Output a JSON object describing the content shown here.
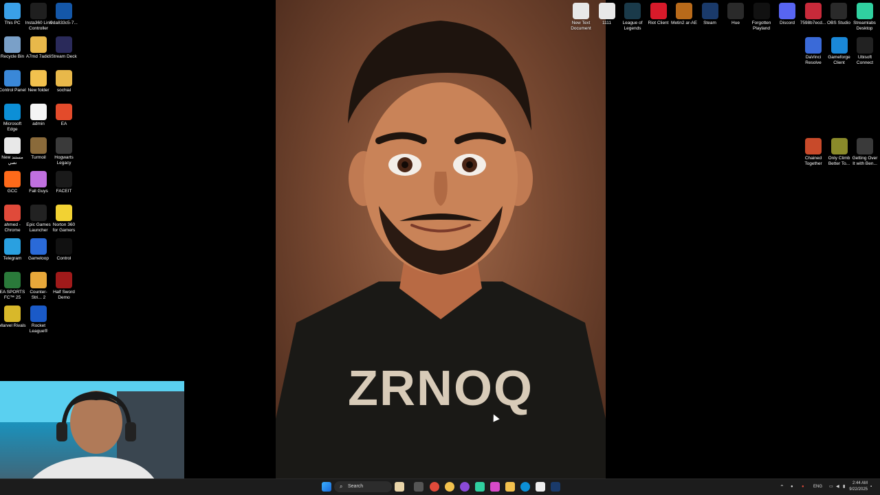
{
  "left_icons": [
    {
      "label": "This PC",
      "color": "#3aa0e8"
    },
    {
      "label": "Insta360 Link Controller",
      "color": "#1f1f1f"
    },
    {
      "label": "9da833c5-7...",
      "color": "#1457a8"
    },
    {
      "label": "Recycle Bin",
      "color": "#7aa0c8"
    },
    {
      "label": "A7md 7adidi",
      "color": "#e8b84a"
    },
    {
      "label": "Stream Deck",
      "color": "#2a2a5a"
    },
    {
      "label": "Control Panel",
      "color": "#3a88d8"
    },
    {
      "label": "New folder",
      "color": "#f2c14e"
    },
    {
      "label": "sochial",
      "color": "#e8b84a"
    },
    {
      "label": "Microsoft Edge",
      "color": "#0c8fd6"
    },
    {
      "label": "admin",
      "color": "#f5f5f5"
    },
    {
      "label": "EA",
      "color": "#e34b2b"
    },
    {
      "label": "New مستند نصي",
      "color": "#e8e8e8"
    },
    {
      "label": "Turmoil",
      "color": "#8a6a3a"
    },
    {
      "label": "Hogwarts Legacy",
      "color": "#3a3a3a"
    },
    {
      "label": "GCC",
      "color": "#ff6a1a"
    },
    {
      "label": "Fall Guys",
      "color": "#c070e0"
    },
    {
      "label": "FACEIT",
      "color": "#1a1a1a"
    },
    {
      "label": "ahmed - Chrome",
      "color": "#e04a3a"
    },
    {
      "label": "Epic Games Launcher",
      "color": "#222"
    },
    {
      "label": "Norton 360 for Gamers",
      "color": "#f2d233"
    },
    {
      "label": "Telegram",
      "color": "#2aa0e0"
    },
    {
      "label": "Gameloop",
      "color": "#2a6ad8"
    },
    {
      "label": "Control",
      "color": "#111"
    },
    {
      "label": "EA SPORTS FC™ 25",
      "color": "#2a7a3a"
    },
    {
      "label": "Counter-Stri... 2",
      "color": "#e8a83a"
    },
    {
      "label": "Half Sword Demo",
      "color": "#a01a1a"
    },
    {
      "label": "Marvel Rivals",
      "color": "#d8b82a"
    },
    {
      "label": "Rocket League®",
      "color": "#1a5ac8"
    }
  ],
  "right_icons_row1": [
    {
      "label": "New Text Document",
      "color": "#e8e8e8"
    },
    {
      "label": "1111",
      "color": "#e8e8e8"
    },
    {
      "label": "League of Legends",
      "color": "#1a3a4a"
    },
    {
      "label": "Riot Client",
      "color": "#d81a2a"
    },
    {
      "label": "Metin2 ar-AE",
      "color": "#b86a1a"
    },
    {
      "label": "Steam",
      "color": "#1a3a6a"
    },
    {
      "label": "Hue",
      "color": "#2a2a2a"
    },
    {
      "label": "Forgotten Playland",
      "color": "#111"
    },
    {
      "label": "Discord",
      "color": "#5865f2"
    },
    {
      "label": "7598b7ecd...",
      "color": "#c82a3a"
    },
    {
      "label": "OBS Studio",
      "color": "#2a2a2a"
    },
    {
      "label": "Streamlabs Desktop",
      "color": "#30d0a0"
    }
  ],
  "right_icons_row2": [
    {
      "label": "DaVinci Resolve",
      "color": "#3a6ad8"
    },
    {
      "label": "Gameforge Client",
      "color": "#1a88d8"
    },
    {
      "label": "Ubisoft Connect",
      "color": "#222"
    }
  ],
  "right_icons_row3": [
    {
      "label": "Chained Together",
      "color": "#c84a2a"
    },
    {
      "label": "Only Climb Better To...",
      "color": "#8a8a2a"
    },
    {
      "label": "Getting Over It with Ben...",
      "color": "#3a3a3a"
    }
  ],
  "wallpaper": {
    "shirt_text": "ZRNOQ"
  },
  "taskbar": {
    "search_placeholder": "Search",
    "language": "ENG",
    "time": "2:44 AM",
    "date": "9/22/2025"
  }
}
